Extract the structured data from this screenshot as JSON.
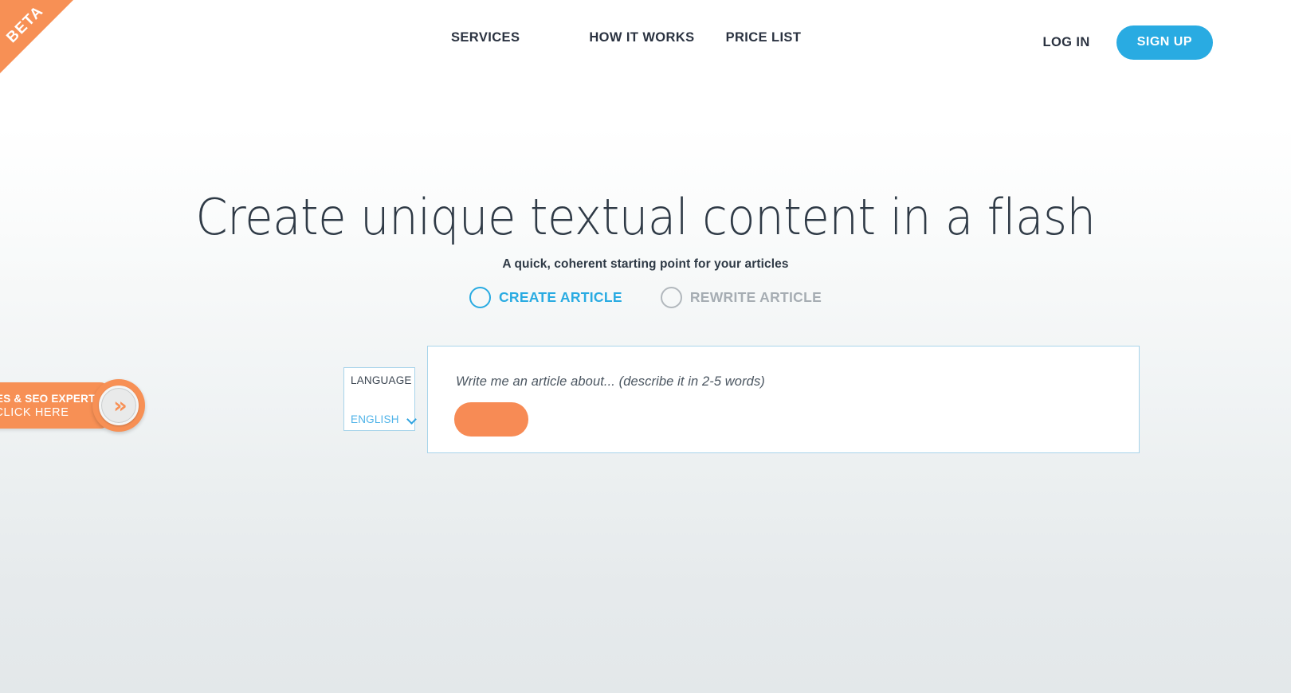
{
  "ribbon": {
    "label": "BETA"
  },
  "nav": {
    "items": [
      {
        "label": "SERVICES",
        "name": "nav-link-services"
      },
      {
        "label": "HOW IT WORKS",
        "name": "nav-link-how-it-works"
      },
      {
        "label": "PRICE LIST",
        "name": "nav-link-price-list"
      }
    ],
    "login_label": "LOG IN",
    "signup_label": "SIGN UP"
  },
  "hero": {
    "title": "Create unique textual content in a flash",
    "subtitle": "A quick, coherent starting point for your articles"
  },
  "modes": [
    {
      "label": "CREATE ARTICLE",
      "selected": true,
      "color": "#29abe2"
    },
    {
      "label": "REWRITE ARTICLE",
      "selected": false,
      "color": "#a6adb3"
    }
  ],
  "language": {
    "title": "LANGUAGE",
    "selected": "ENGLISH",
    "options": [
      "ENGLISH"
    ],
    "chevron_icon": "chevron-down-icon"
  },
  "prompt": {
    "placeholder": "Write me an article about... (describe it in 2-5 words)",
    "value": "",
    "submit_label": ""
  },
  "promo": {
    "line1": "GENCIES & SEO EXPERTS",
    "line2": "CLICK HERE",
    "arrow_icon": "double-chevron-right-icon"
  },
  "colors": {
    "accent_blue": "#29abe2",
    "accent_orange": "#f79055",
    "text_dark": "#2a3240",
    "panel_border": "#a8d4ea",
    "muted_gray": "#a6adb3"
  }
}
